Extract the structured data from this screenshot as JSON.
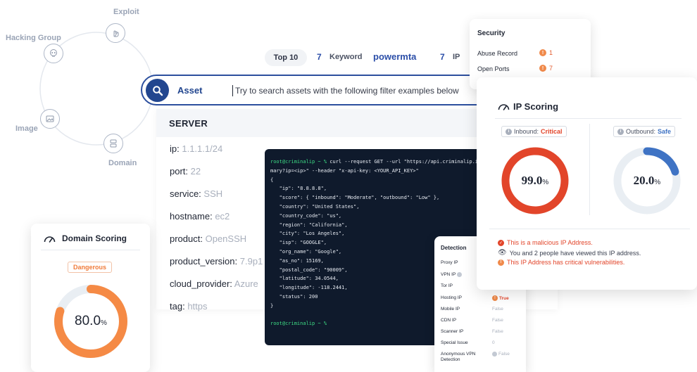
{
  "orbit": {
    "labels": {
      "exploit": "Exploit",
      "hacking_group": "Hacking Group",
      "image": "Image",
      "domain": "Domain"
    }
  },
  "keywords": {
    "top": "Top 10",
    "count1": "7",
    "keyword_label": "Keyword",
    "keyword_value": "powermta",
    "count2": "7",
    "ip_label": "IP"
  },
  "search": {
    "category": "Asset",
    "placeholder": "Try to search assets with the following filter examples below"
  },
  "server": {
    "title": "SERVER",
    "rows": [
      {
        "k": "ip:",
        "v": "1.1.1.1/24"
      },
      {
        "k": "port:",
        "v": "22"
      },
      {
        "k": "service:",
        "v": "SSH"
      },
      {
        "k": "hostname:",
        "v": "ec2"
      },
      {
        "k": "product:",
        "v": "OpenSSH"
      },
      {
        "k": "product_version:",
        "v": "7.9p1"
      },
      {
        "k": "cloud_provider:",
        "v": "Azure"
      },
      {
        "k": "tag:",
        "v": "https"
      }
    ]
  },
  "terminal": {
    "prompt": "root@criminalip ~ %",
    "lines": [
      " curl --request GET --url \"https://api.criminalip.io",
      "mary?ip=<ip>\" --header \"x-api-key: <YOUR_API_KEY>\"",
      "",
      "{",
      "   \"ip\": \"8.8.8.8\",",
      "   \"score\": { \"inbound\": \"Moderate\", \"outbound\": \"Low\" },",
      "   \"country\": \"United States\",",
      "   \"country_code\": \"us\",",
      "   \"region\": \"California\",",
      "   \"city\": \"Los Angeles\",",
      "   \"isp\": \"GOOGLE\",",
      "   \"org_name\": \"Google\",",
      "   \"as_no\": 15169,",
      "   \"postal_code\": \"90009\",",
      "   \"latitude\": 34.0544,",
      "   \"longitude\": -118.2441,",
      "   \"status\": 200",
      "}"
    ]
  },
  "security": {
    "title": "Security",
    "abuse_label": "Abuse Record",
    "abuse_value": "1",
    "ports_label": "Open Ports",
    "ports_value": "7"
  },
  "ip_scoring": {
    "title": "IP Scoring",
    "inbound_label": "Inbound:",
    "inbound_value": "Critical",
    "outbound_label": "Outbound:",
    "outbound_value": "Safe",
    "inbound_score": "99.0",
    "outbound_score": "20.0",
    "percent": "%",
    "inbound_fraction": 0.99,
    "outbound_fraction": 0.2,
    "notes": [
      "This is a malicious IP Address.",
      "You and 2 people have viewed this IP address.",
      "This IP Address has critical vulnerabilities."
    ],
    "colors": {
      "critical": "#e2452a",
      "safe": "#3f73c4",
      "track": "#e9eef3"
    }
  },
  "detection": {
    "title": "Detection",
    "rows": [
      {
        "k": "Proxy IP",
        "v": ""
      },
      {
        "k": "VPN IP",
        "v": ""
      },
      {
        "k": "Tor IP",
        "v": ""
      },
      {
        "k": "Hosting IP",
        "v": "True"
      },
      {
        "k": "Mobile IP",
        "v": "False"
      },
      {
        "k": "CDN IP",
        "v": "False"
      },
      {
        "k": "Scanner IP",
        "v": "False"
      },
      {
        "k": "Special Issue",
        "v": "0"
      },
      {
        "k": "Anonymous VPN Detection",
        "v": "False"
      }
    ]
  },
  "domain_scoring": {
    "title": "Domain Scoring",
    "badge": "Dangerous",
    "score": "80.0",
    "percent": "%",
    "fraction": 0.8,
    "colors": {
      "ring": "#f58a45",
      "track": "#e9eef3"
    }
  }
}
